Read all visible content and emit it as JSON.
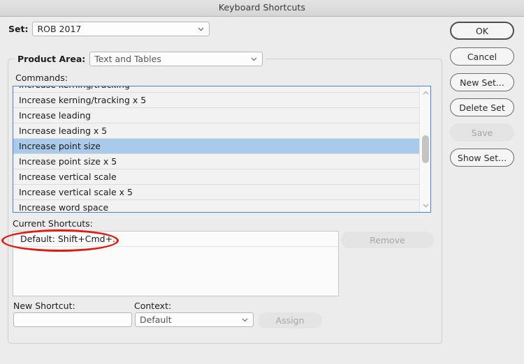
{
  "window": {
    "title": "Keyboard Shortcuts"
  },
  "set_row": {
    "label": "Set:",
    "value": "ROB 2017",
    "chevron_icon": "chevron-down-icon"
  },
  "product_area": {
    "label": "Product Area:",
    "value": "Text and Tables",
    "chevron_icon": "chevron-down-icon"
  },
  "commands": {
    "label": "Commands:",
    "selected_index": 4,
    "items": [
      "Increase kerning/tracking",
      "Increase kerning/tracking x 5",
      "Increase leading",
      "Increase leading x 5",
      "Increase point size",
      "Increase point size x 5",
      "Increase vertical scale",
      "Increase vertical scale x 5",
      "Increase word space"
    ],
    "scrollbar": {
      "up_arrow_icon": "chevron-up-icon",
      "down_arrow_icon": "chevron-down-icon"
    }
  },
  "current_shortcuts": {
    "label": "Current Shortcuts:",
    "items": [
      "Default: Shift+Cmd+."
    ],
    "remove_label": "Remove",
    "remove_disabled": true
  },
  "new_shortcut": {
    "label": "New Shortcut:",
    "value": "",
    "placeholder": ""
  },
  "context": {
    "label": "Context:",
    "value": "Default",
    "chevron_icon": "chevron-down-icon"
  },
  "assign": {
    "label": "Assign",
    "disabled": true
  },
  "buttons": {
    "ok": "OK",
    "cancel": "Cancel",
    "new_set": "New Set...",
    "delete_set": "Delete Set",
    "save": "Save",
    "show_set": "Show Set..."
  },
  "annotation": {
    "shape": "ellipse",
    "color": "#e01b12",
    "target": "Default: Shift+Cmd+."
  }
}
